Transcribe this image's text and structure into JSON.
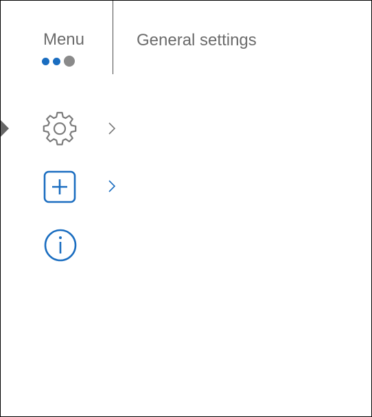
{
  "header": {
    "menu_label": "Menu",
    "title": "General settings",
    "page_dots": [
      {
        "color": "#1a6dc0"
      },
      {
        "color": "#1a6dc0"
      },
      {
        "color": "#8a8a8a"
      }
    ]
  },
  "menu": {
    "items": [
      {
        "icon": "gear-icon",
        "color": "#7a7a7a",
        "selected": true,
        "has_submenu": true
      },
      {
        "icon": "plus-box-icon",
        "color": "#1a6dc0",
        "selected": false,
        "has_submenu": true
      },
      {
        "icon": "info-icon",
        "color": "#1a6dc0",
        "selected": false,
        "has_submenu": false
      }
    ]
  },
  "colors": {
    "accent": "#1a6dc0",
    "text_gray": "#6b6b6b",
    "icon_gray": "#7a7a7a",
    "selector_gray": "#666666"
  }
}
